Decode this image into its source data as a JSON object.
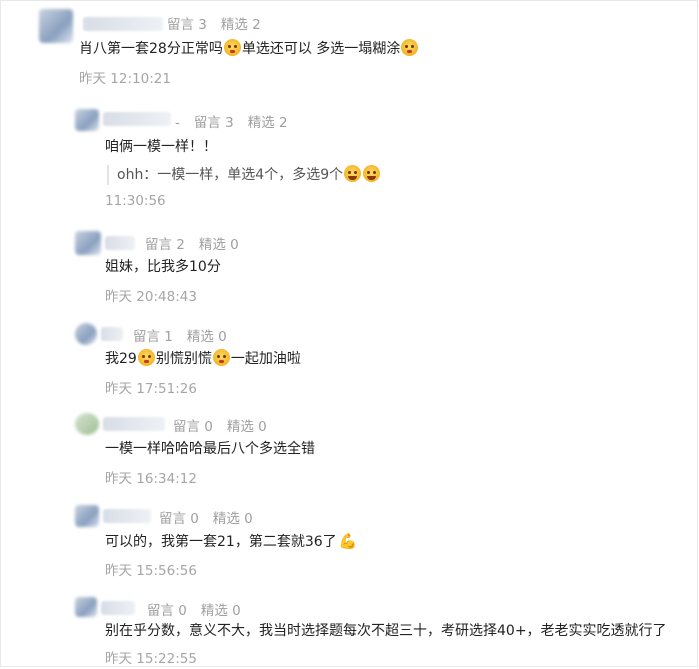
{
  "comments": [
    {
      "meta_left": "留言 3",
      "meta_right": "精选 2",
      "text_a": "肖八第一套28分正常吗",
      "text_b": "单选还可以 多选一塌糊涂",
      "time": "昨天 12:10:21"
    },
    {
      "name_suffix": "-",
      "meta_left": "留言 3",
      "meta_right": "精选 2",
      "text": "咱俩一模一样！！",
      "quote": "ohh：一模一样，单选4个，多选9个",
      "time": "11:30:56"
    },
    {
      "meta_left": "留言 2",
      "meta_right": "精选 0",
      "text": "姐妹，比我多10分",
      "time": "昨天 20:48:43"
    },
    {
      "meta_left": "留言 1",
      "meta_right": "精选 0",
      "text_a": "我29",
      "text_b": "别慌别慌",
      "text_c": "一起加油啦",
      "time": "昨天 17:51:26"
    },
    {
      "meta_left": "留言 0",
      "meta_right": "精选 0",
      "text": "一模一样哈哈哈最后八个多选全错",
      "time": "昨天 16:34:12"
    },
    {
      "meta_left": "留言 0",
      "meta_right": "精选 0",
      "text": "可以的，我第一套21，第二套就36了",
      "time": "昨天 15:56:56"
    },
    {
      "meta_left": "留言 0",
      "meta_right": "精选 0",
      "text": "别在乎分数，意义不大，我当时选择题每次不超三十，考研选择40+，老老实实吃透就行了",
      "time": "昨天 15:22:55"
    }
  ]
}
